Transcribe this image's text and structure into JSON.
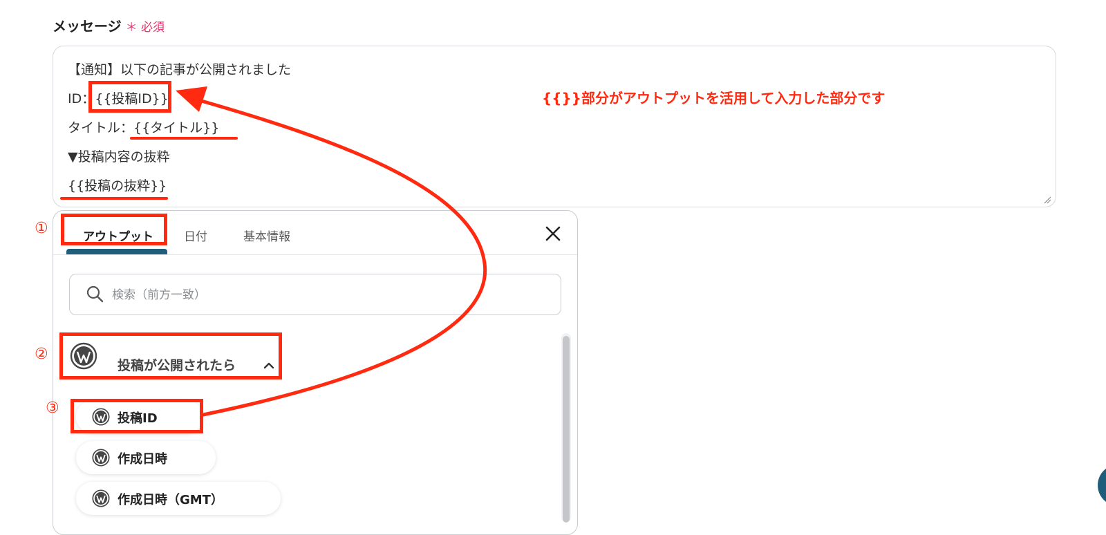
{
  "field": {
    "label": "メッセージ",
    "required_mark": "＊",
    "required_text": "必須"
  },
  "message": {
    "lines": [
      "【通知】以下の記事が公開されました",
      "ID：{{投稿ID}}",
      "タイトル：{{タイトル}}",
      "▼投稿内容の抜粋",
      "{{投稿の抜粋}}"
    ]
  },
  "annotation": {
    "note": "{{}}部分がアウトプットを活用して入力した部分です",
    "steps": [
      "①",
      "②",
      "③"
    ],
    "color": "#ff2a10"
  },
  "panel": {
    "tabs": [
      {
        "label": "アウトプット",
        "active": true
      },
      {
        "label": "日付",
        "active": false
      },
      {
        "label": "基本情報",
        "active": false
      }
    ],
    "close_icon": "close-icon",
    "search": {
      "placeholder": "検索（前方一致）",
      "value": ""
    },
    "group": {
      "title": "投稿が公開されたら",
      "icon": "wordpress-icon",
      "expanded": true
    },
    "items": [
      {
        "label": "投稿ID",
        "icon": "wordpress-icon"
      },
      {
        "label": "作成日時",
        "icon": "wordpress-icon"
      },
      {
        "label": "作成日時（GMT）",
        "icon": "wordpress-icon"
      }
    ]
  },
  "colors": {
    "accent": "#1f5d7a",
    "required": "#e8336b",
    "annotation": "#ff2a10"
  }
}
